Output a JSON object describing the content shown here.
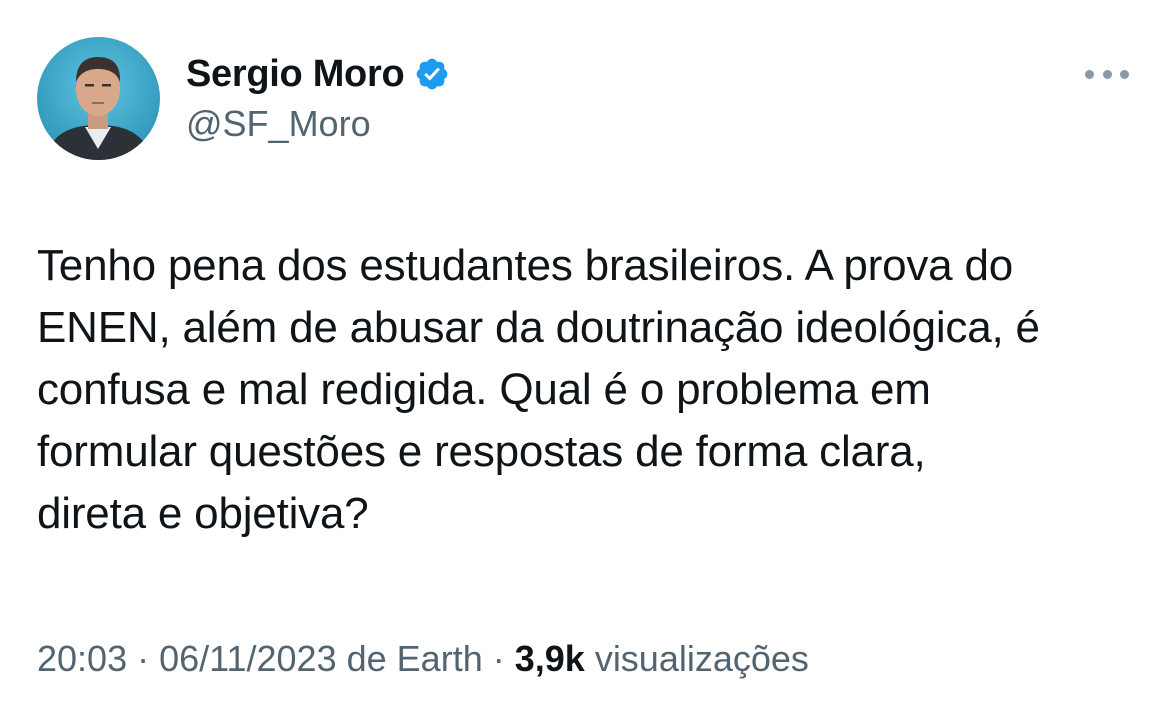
{
  "author": {
    "display_name": "Sergio Moro",
    "handle": "@SF_Moro",
    "verified": true,
    "avatar_icon": "profile-photo"
  },
  "tweet": {
    "text": "Tenho pena dos estudantes brasileiros. A prova do ENEN, além de abusar da doutrinação ideológica, é confusa e mal redigida. Qual é o problema em formular questões e respostas de forma clara, direta e objetiva?",
    "text_lines": [
      "Tenho pena dos estudantes brasileiros. A prova do",
      "ENEN, além de abusar da doutrinação ideológica, é",
      "confusa e mal redigida. Qual é o problema em",
      "formular questões e respostas de forma clara,",
      "direta e objetiva?"
    ]
  },
  "meta": {
    "time": "20:03",
    "separator": " · ",
    "date": "06/11/2023",
    "source": "de Earth",
    "views_count": "3,9k",
    "views_label": "visualizações"
  },
  "colors": {
    "text_primary": "#0f1419",
    "text_secondary": "#536471",
    "verified_blue": "#1d9bf0",
    "more_dots": "#8b98a5"
  },
  "icons": {
    "verified": "verified-badge-icon",
    "more": "more-options-icon"
  }
}
